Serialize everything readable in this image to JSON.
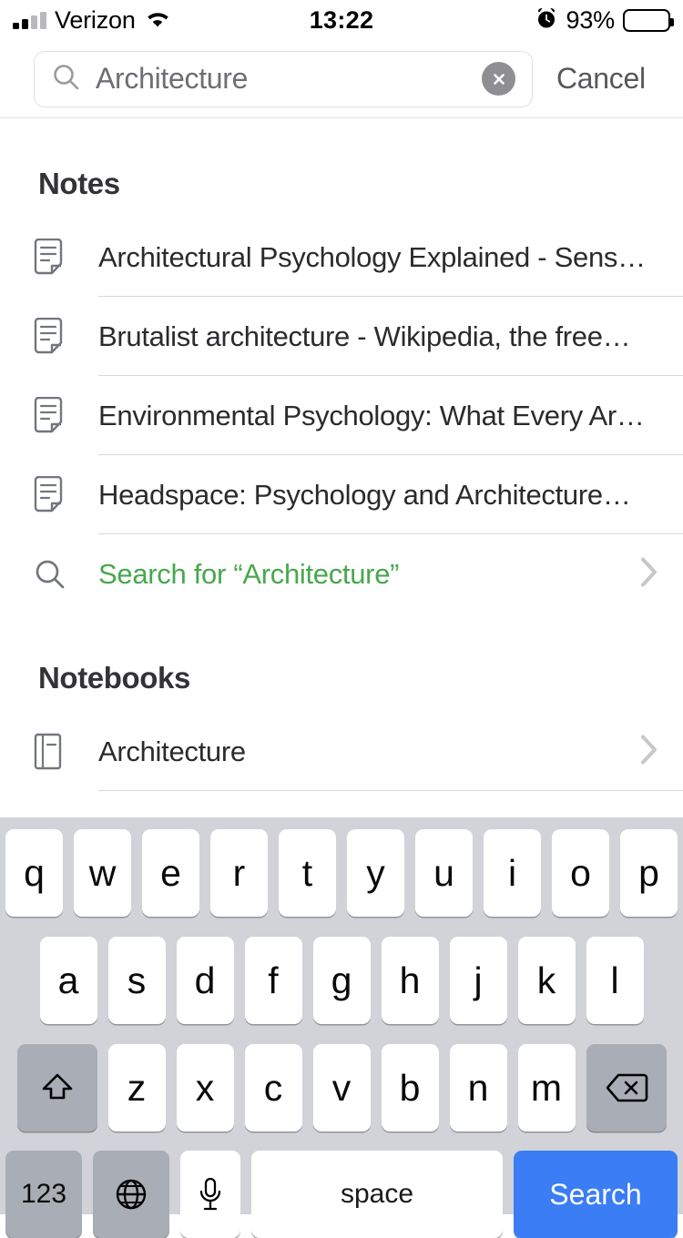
{
  "status_bar": {
    "carrier": "Verizon",
    "wifi_icon": "wifi-icon",
    "signal_icon": "cellular-signal-icon",
    "time": "13:22",
    "alarm_icon": "alarm-clock-icon",
    "battery_percent": "93%",
    "battery_level": 93
  },
  "search": {
    "icon": "search-icon",
    "query": "Architecture",
    "placeholder": "Search",
    "clear_icon": "clear-circle-icon",
    "cancel_label": "Cancel"
  },
  "sections": [
    {
      "title": "Notes",
      "rows": [
        {
          "icon": "note-document-icon",
          "pre": "Architectural Psychology Explained - Sens…",
          "hit": "",
          "post": "",
          "chevron": false
        },
        {
          "icon": "note-document-icon",
          "pre": "Brutalist ",
          "hit": "architecture",
          "post": " - Wikipedia, the free…",
          "chevron": false
        },
        {
          "icon": "note-document-icon",
          "pre": "Environmental Psychology: What Every Ar…",
          "hit": "",
          "post": "",
          "chevron": false
        },
        {
          "icon": "note-document-icon",
          "pre": "Headspace: Psychology and ",
          "hit": "Architecture",
          "post": "…",
          "chevron": false
        },
        {
          "icon": "search-icon",
          "pre": "Search for “Architecture”",
          "hit": "",
          "post": "",
          "chevron": true,
          "accent": true
        }
      ]
    },
    {
      "title": "Notebooks",
      "rows": [
        {
          "icon": "notebook-icon",
          "pre": "",
          "hit": "Architecture",
          "post": "",
          "chevron": true
        }
      ]
    }
  ],
  "keyboard": {
    "row1": [
      "q",
      "w",
      "e",
      "r",
      "t",
      "y",
      "u",
      "i",
      "o",
      "p"
    ],
    "row2": [
      "a",
      "s",
      "d",
      "f",
      "g",
      "h",
      "j",
      "k",
      "l"
    ],
    "row3": [
      "z",
      "x",
      "c",
      "v",
      "b",
      "n",
      "m"
    ],
    "shift_icon": "shift-arrow-icon",
    "delete_icon": "backspace-delete-icon",
    "numbers_label": "123",
    "globe_icon": "globe-language-icon",
    "mic_icon": "microphone-icon",
    "space_label": "space",
    "return_label": "Search"
  },
  "colors": {
    "accent_green": "#45a347",
    "keyboard_blue": "#3a7df5",
    "keyboard_bg": "#d1d3d9",
    "modifier_key": "#a9adb5"
  }
}
